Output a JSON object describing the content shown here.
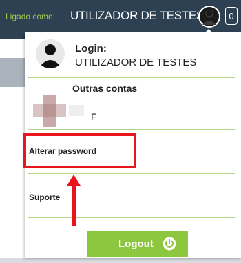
{
  "topbar": {
    "logged_as_label": "Ligado como:",
    "user_name": "UTILIZADOR DE TESTES",
    "counter": "0",
    "background_color": "#2e4153",
    "logged_as_color": "#9bcb4c"
  },
  "menu": {
    "login_label": "Login:",
    "login_value": "UTILIZADOR DE TESTES",
    "other_accounts_title": "Outras contas",
    "other_account_name": "F",
    "items": [
      {
        "label": "Alterar password",
        "highlighted": true
      },
      {
        "label": "Suporte",
        "highlighted": false
      }
    ],
    "logout_label": "Logout",
    "logout_icon": "power-icon",
    "divider_color": "#b6d486",
    "logout_color": "#8dc63f"
  },
  "annotation": {
    "highlight_color": "#e8151c",
    "arrow_color": "#e8151c"
  }
}
